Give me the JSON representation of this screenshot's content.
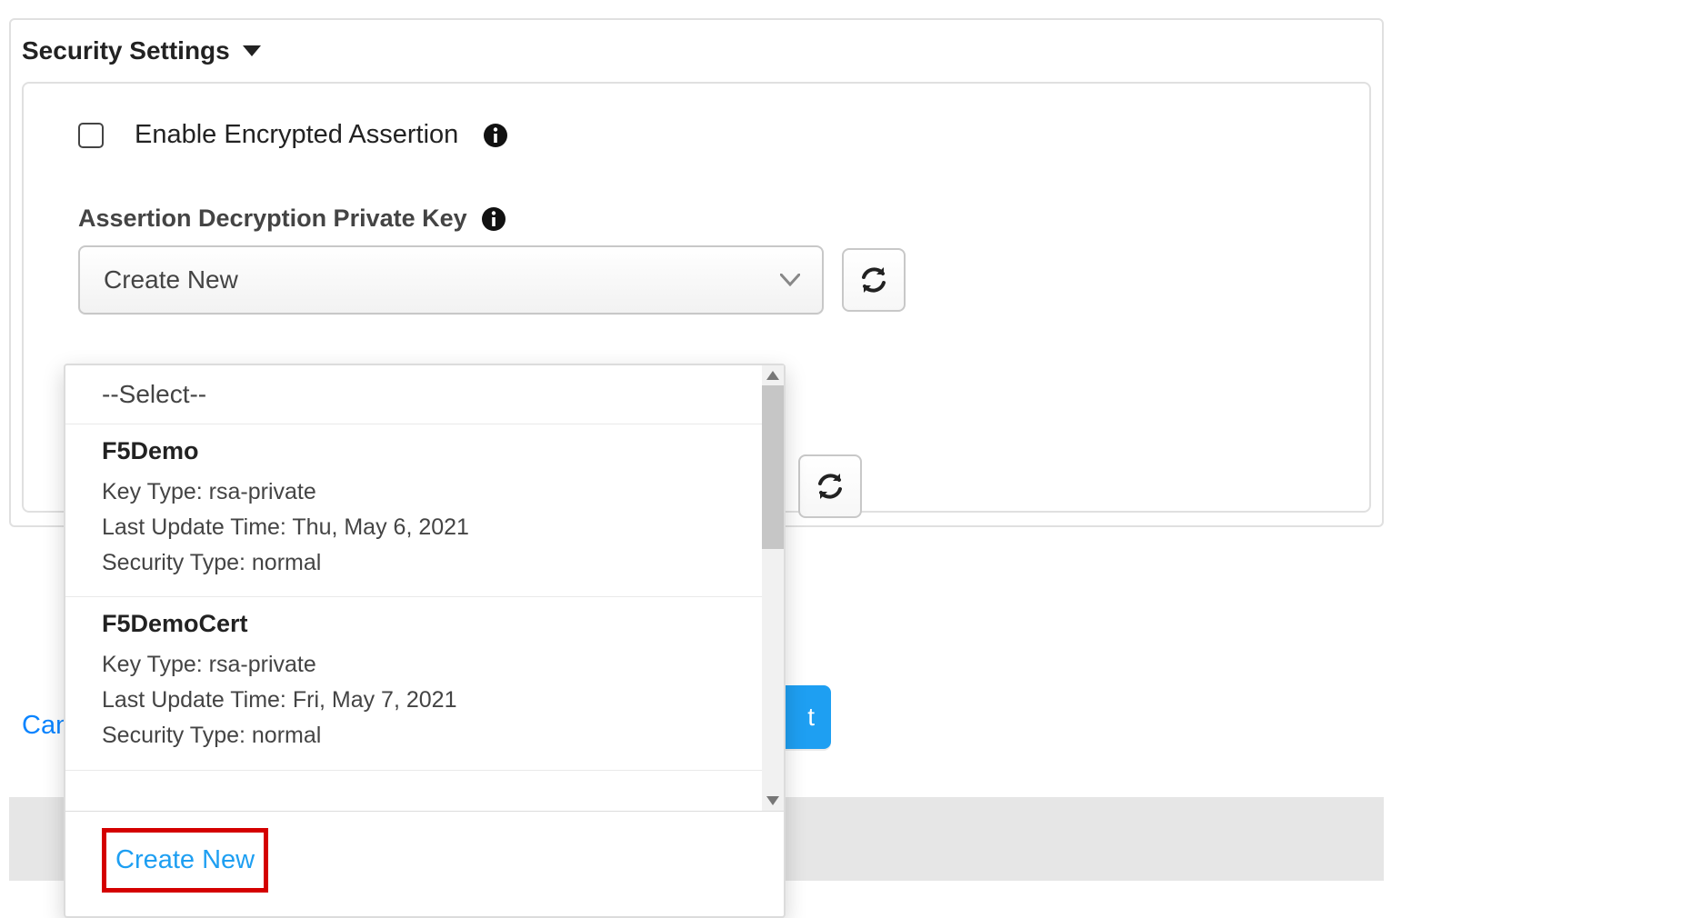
{
  "section": {
    "title": "Security Settings"
  },
  "enable": {
    "label": "Enable Encrypted Assertion"
  },
  "assertion": {
    "label": "Assertion Decryption Private Key",
    "selected": "Create New"
  },
  "dropdown": {
    "placeholder": "--Select--",
    "items": [
      {
        "name": "F5Demo",
        "key_type_label": "Key Type:",
        "key_type": "rsa-private",
        "last_update_label": "Last Update Time:",
        "last_update": "Thu, May 6, 2021",
        "security_type_label": "Security Type:",
        "security_type": "normal"
      },
      {
        "name": "F5DemoCert",
        "key_type_label": "Key Type:",
        "key_type": "rsa-private",
        "last_update_label": "Last Update Time:",
        "last_update": "Fri, May 7, 2021",
        "security_type_label": "Security Type:",
        "security_type": "normal"
      }
    ],
    "create_new": "Create New"
  },
  "footer": {
    "cancel": "Can",
    "next_fragment": "t"
  }
}
